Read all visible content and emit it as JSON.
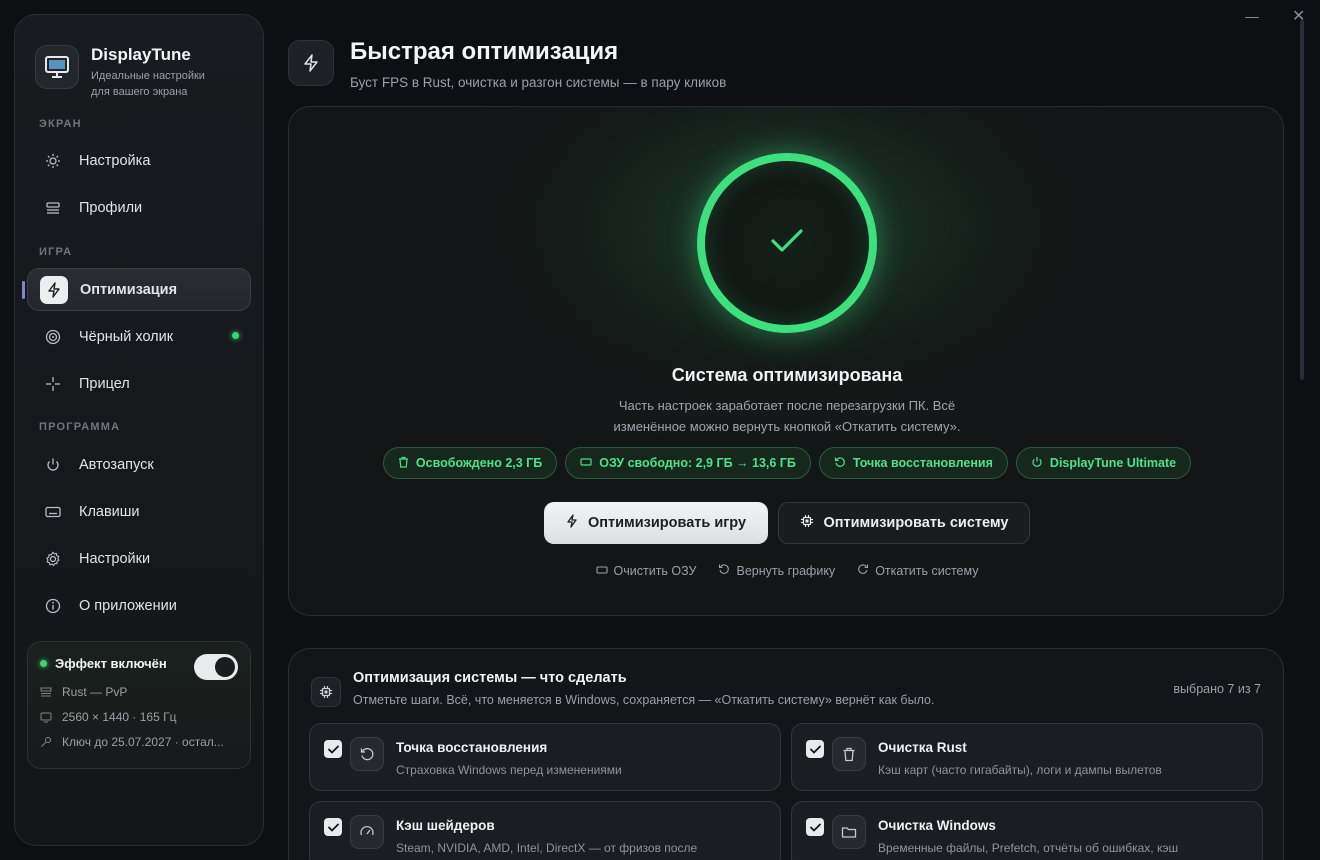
{
  "app": {
    "name": "DisplayTune",
    "tagline_line1": "Идеальные настройки",
    "tagline_line2": "для вашего экрана"
  },
  "sidebar": {
    "sections": {
      "screen": "ЭКРАН",
      "game": "ИГРА",
      "program": "ПРОГРАММА"
    },
    "items": [
      {
        "label": "Настройка",
        "icon": "sun-icon"
      },
      {
        "label": "Профили",
        "icon": "profiles-icon"
      },
      {
        "label": "Оптимизация",
        "icon": "lightning-icon",
        "active": true
      },
      {
        "label": "Чёрный холик",
        "icon": "target-icon",
        "badge": "green-dot"
      },
      {
        "label": "Прицел",
        "icon": "crosshair-icon"
      },
      {
        "label": "Автозапуск",
        "icon": "power-icon"
      },
      {
        "label": "Клавиши",
        "icon": "keyboard-icon"
      },
      {
        "label": "Настройки",
        "icon": "gear-icon"
      },
      {
        "label": "О приложении",
        "icon": "info-icon"
      }
    ],
    "status": {
      "title": "Эффект включён",
      "enabled": true,
      "profile": "Rust — PvP",
      "resolution": "2560 × 1440 · 165 Гц",
      "key": "Ключ до 25.07.2027 · остал..."
    }
  },
  "header": {
    "title": "Быстрая оптимизация",
    "subtitle": "Буст FPS в Rust, очистка и разгон системы — в пару кликов"
  },
  "hero": {
    "title": "Система оптимизирована",
    "description_line1": "Часть настроек заработает после перезагрузки ПК. Всё",
    "description_line2": "изменённое можно вернуть кнопкой «Откатить систему».",
    "chips": [
      "Освобождено 2,3 ГБ",
      "ОЗУ свободно: 2,9 ГБ → 13,6 ГБ",
      "Точка восстановления",
      "DisplayTune Ultimate"
    ],
    "primary_button": "Оптимизировать игру",
    "secondary_button": "Оптимизировать систему",
    "links": [
      "Очистить ОЗУ",
      "Вернуть графику",
      "Откатить систему"
    ],
    "accent_color": "#3ee07e"
  },
  "steps": {
    "title": "Оптимизация системы — что сделать",
    "subtitle": "Отметьте шаги. Всё, что меняется в Windows, сохраняется — «Откатить систему» вернёт как было.",
    "count": "выбрано 7 из 7",
    "items": [
      {
        "title": "Точка восстановления",
        "desc": "Страховка Windows перед изменениями",
        "icon": "restore-icon",
        "checked": true
      },
      {
        "title": "Очистка Rust",
        "desc": "Кэш карт (часто гигабайты), логи и дампы вылетов",
        "icon": "trash-icon",
        "checked": true
      },
      {
        "title": "Кэш шейдеров",
        "desc": "Steam, NVIDIA, AMD, Intel, DirectX — от фризов после",
        "icon": "gauge-icon",
        "checked": true
      },
      {
        "title": "Очистка Windows",
        "desc": "Временные файлы, Prefetch, отчёты об ошибках, кэш",
        "icon": "folder-icon",
        "checked": true
      }
    ]
  }
}
